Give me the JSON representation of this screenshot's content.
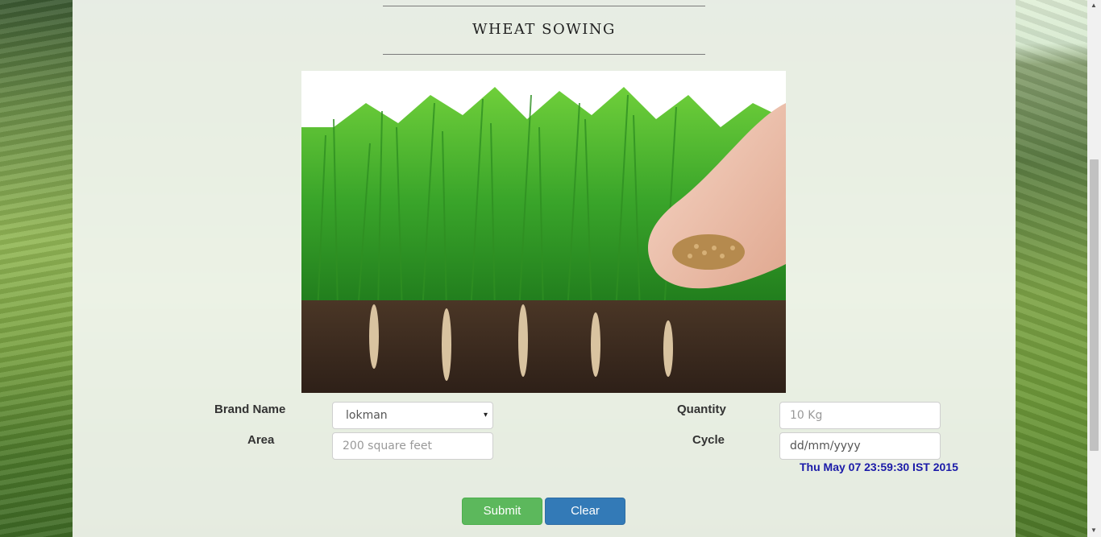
{
  "page": {
    "title": "WHEAT SOWING"
  },
  "form": {
    "brand_label": "Brand Name",
    "brand_value": "lokman",
    "area_label": "Area",
    "area_placeholder": "200 square feet",
    "quantity_label": "Quantity",
    "quantity_placeholder": "10 Kg",
    "cycle_label": "Cycle",
    "cycle_placeholder": "dd/mm/yyyy",
    "datestamp": "Thu May 07 23:59:30 IST 2015",
    "submit_label": "Submit",
    "clear_label": "Clear"
  },
  "icons": {
    "select_caret": "▾",
    "scroll_up": "▲",
    "scroll_down": "▼"
  },
  "colors": {
    "submit": "#5cb85c",
    "clear": "#337ab7",
    "datestamp": "#1a1aa8"
  }
}
